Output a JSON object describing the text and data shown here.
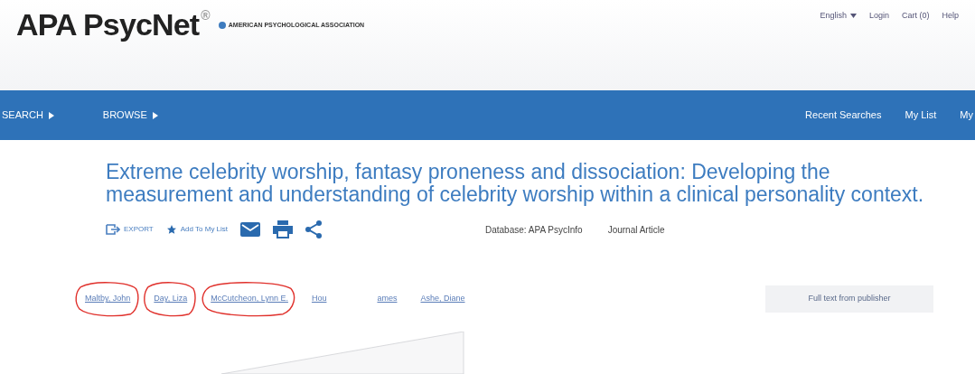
{
  "header": {
    "logo": "APA PsycNet",
    "logo_mark": "®",
    "org": "AMERICAN PSYCHOLOGICAL ASSOCIATION",
    "links": [
      {
        "label": "English",
        "dropdown": true
      },
      {
        "label": "Login",
        "dropdown": false
      },
      {
        "label": "Cart (0)",
        "dropdown": false
      },
      {
        "label": "Help",
        "dropdown": false
      }
    ]
  },
  "nav": {
    "left": [
      {
        "label": "SEARCH"
      },
      {
        "label": "BROWSE"
      }
    ],
    "right": [
      {
        "label": "Recent Searches"
      },
      {
        "label": "My List"
      },
      {
        "label": "My"
      }
    ]
  },
  "record": {
    "title": "Extreme celebrity worship, fantasy proneness and dissociation: Developing the measurement and understanding of celebrity worship within a clinical personality context.",
    "actions": [
      {
        "kind": "export",
        "label": "EXPORT"
      },
      {
        "kind": "add",
        "label": "Add To My List"
      },
      {
        "kind": "email"
      },
      {
        "kind": "print"
      },
      {
        "kind": "share"
      }
    ],
    "database": "Database: APA PsycInfo",
    "type": "Journal Article",
    "authors": [
      {
        "name": "Maltby, John",
        "circled": true
      },
      {
        "name": "Day, Liza",
        "circled": true
      },
      {
        "name": "McCutcheon, Lynn E.",
        "circled": true
      },
      {
        "name": "Hou",
        "name_after_cover": "ames",
        "circled": false
      },
      {
        "name": "Ashe, Diane",
        "circled": false
      }
    ],
    "full_text_button": "Full text from publisher"
  }
}
